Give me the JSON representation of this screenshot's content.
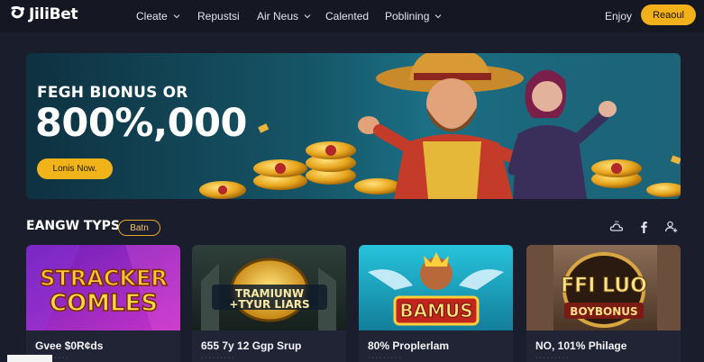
{
  "header": {
    "logo_text": "JiliBet",
    "nav": [
      {
        "label": "Cleate",
        "has_dropdown": true
      },
      {
        "label": "Repustsi",
        "has_dropdown": false
      },
      {
        "label": "Air Neus",
        "has_dropdown": true
      },
      {
        "label": "Calented",
        "has_dropdown": false
      },
      {
        "label": "Poblining",
        "has_dropdown": true
      }
    ],
    "login_label": "Enjoy",
    "cta_label": "Reaoul"
  },
  "banner": {
    "subtitle": "FEGH BIONUS OR",
    "amount": "800%,000",
    "button_label": "Lonis Now."
  },
  "section": {
    "title": "EANGW TYPS",
    "badge": "Batn",
    "icons": [
      "cloud-icon",
      "facebook-icon",
      "user-add-icon"
    ]
  },
  "cards": [
    {
      "art_text_1": "STRACKER",
      "art_text_2": "COMLES",
      "title": "Gvee $0R¢ds",
      "sub": "· · · · · · · · ·"
    },
    {
      "art_text_1": "TRAMIUNW",
      "art_text_2": "+TYUR LIARS",
      "title": "655 7y 12 Ggp Srup",
      "sub": "· · · · · · · · ·"
    },
    {
      "art_text_1": "BAMUS",
      "art_text_2": "",
      "title": "80% Proplerlam",
      "sub": "· · · · · · · · ·"
    },
    {
      "art_text_1": "FFI LUO",
      "art_text_2": "BOYBONUS",
      "title": "NO, 101% Philage",
      "sub": "· · · · · · · · ·"
    }
  ],
  "colors": {
    "background": "#1a1d2c",
    "header": "#151722",
    "accent": "#f2b01b",
    "card": "#202434"
  }
}
